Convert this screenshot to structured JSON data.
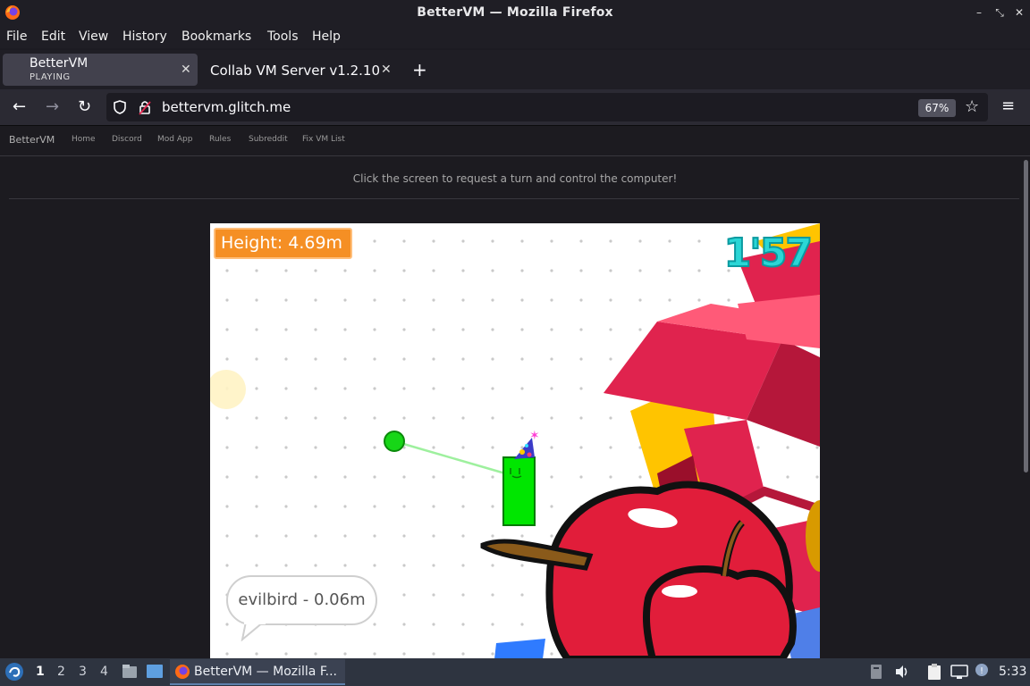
{
  "window": {
    "title": "BetterVM — Mozilla Firefox"
  },
  "menu": [
    "File",
    "Edit",
    "View",
    "History",
    "Bookmarks",
    "Tools",
    "Help"
  ],
  "tabs": [
    {
      "title": "BetterVM",
      "subtitle": "PLAYING",
      "active": true
    },
    {
      "title": "Collab VM Server v1.2.10",
      "active": false
    }
  ],
  "navbar": {
    "url": "bettervm.glitch.me",
    "zoom": "67%"
  },
  "site": {
    "brand": "BetterVM",
    "links": [
      "Home",
      "Discord",
      "Mod App",
      "Rules",
      "Subreddit",
      "Fix VM List"
    ],
    "hint": "Click the screen to request a turn and control the computer!"
  },
  "game": {
    "height_label": "Height: 4.69m",
    "timer": "1'57",
    "player_bubble": "evilbird - 0.06m"
  },
  "taskbar": {
    "workspaces": [
      "1",
      "2",
      "3",
      "4"
    ],
    "active_workspace": "1",
    "app_label": "BetterVM — Mozilla F...",
    "clock": "5:33"
  },
  "colors": {
    "accent": "#5e81ac",
    "height_box": "#f58f24",
    "timer": "#2bd6d6",
    "player": "#00e600"
  }
}
